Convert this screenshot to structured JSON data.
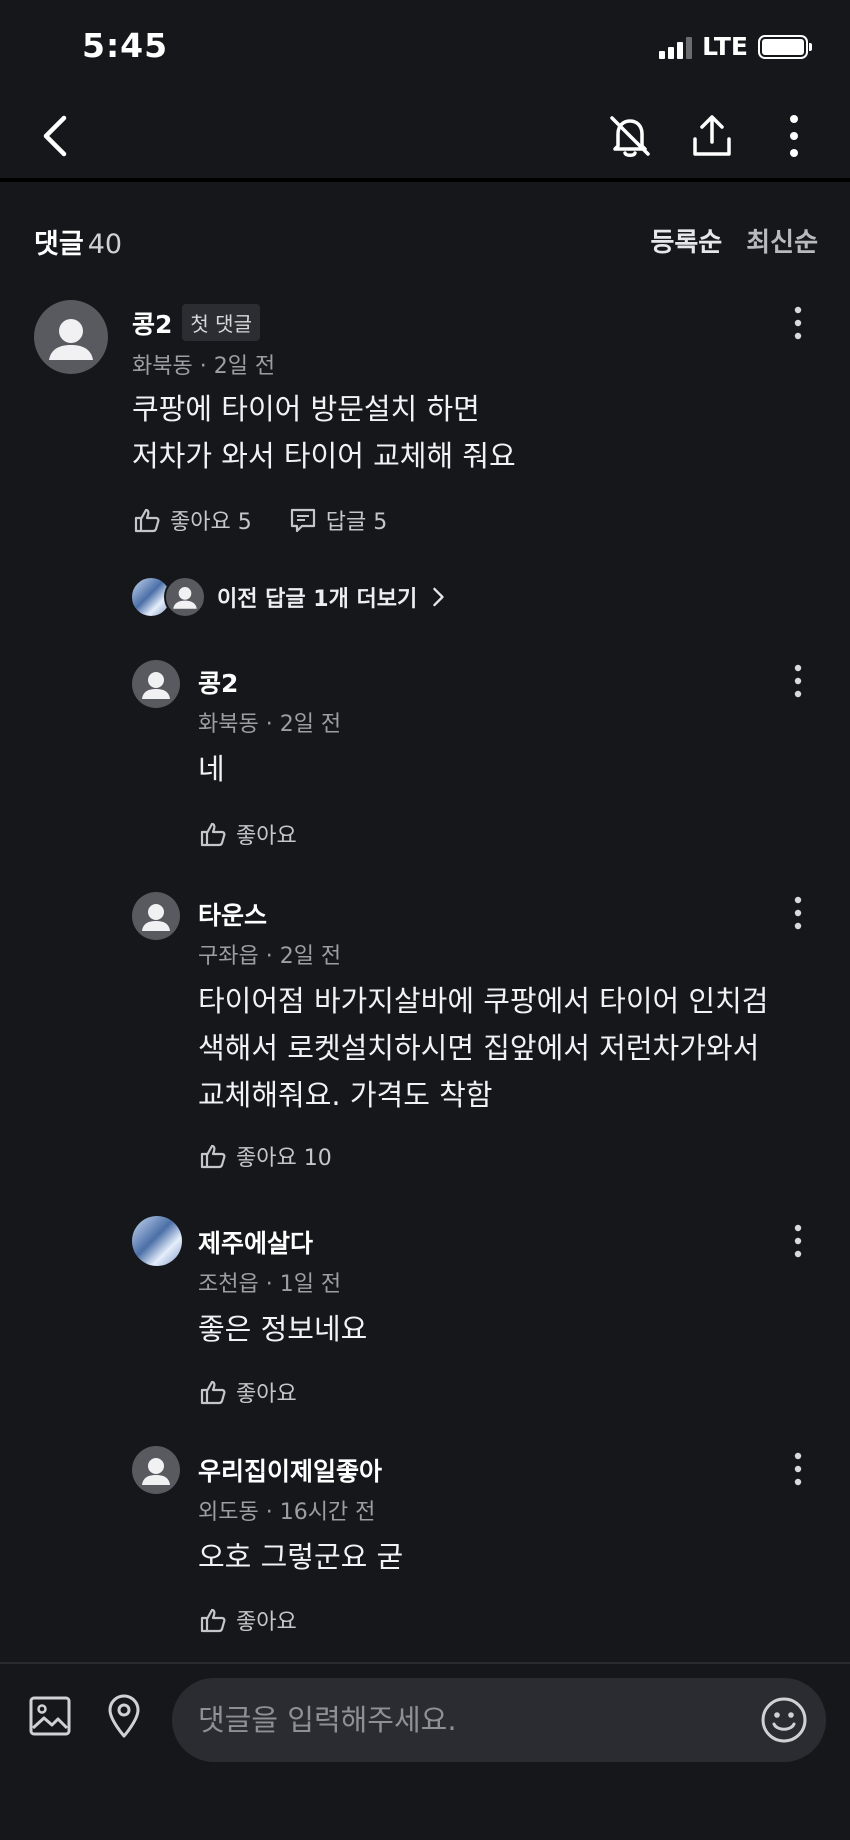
{
  "status": {
    "time": "5:45",
    "network": "LTE"
  },
  "nav": {
    "icons": [
      "back-icon",
      "bell-off-icon",
      "share-icon",
      "more-icon"
    ]
  },
  "header": {
    "title": "댓글",
    "count": "40",
    "sort": [
      "등록순",
      "최신순"
    ]
  },
  "comments": [
    {
      "name": "콩2",
      "badge": "첫 댓글",
      "meta": "화북동 · 2일 전",
      "lines": [
        "쿠팡에 타이어 방문설치 하면",
        "저차가 와서 타이어 교체해 줘요"
      ],
      "like_label": "좋아요 5",
      "reply_label": "답글 5"
    }
  ],
  "more_replies": "이전 답글 1개 더보기",
  "replies": [
    {
      "name": "콩2",
      "meta": "화북동 · 2일 전",
      "lines": [
        "네"
      ],
      "like_label": "좋아요"
    },
    {
      "name": "타운스",
      "meta": "구좌읍 · 2일 전",
      "lines": [
        "타이어점 바가지살바에 쿠팡에서 타이어 인치검",
        "색해서 로켓설치하시면 집앞에서 저런차가와서",
        "교체해줘요. 가격도 착함"
      ],
      "like_label": "좋아요 10"
    },
    {
      "name": "제주에살다",
      "meta": "조천읍 · 1일 전",
      "lines": [
        "좋은 정보네요"
      ],
      "like_label": "좋아요"
    },
    {
      "name": "우리집이제일좋아",
      "meta": "외도동 · 16시간 전",
      "lines": [
        "오호 그렇군요 굳"
      ],
      "like_label": "좋아요"
    }
  ],
  "input": {
    "placeholder": "댓글을 입력해주세요."
  },
  "colors": {
    "background": "#16171b",
    "input_bg": "#2b2c31",
    "text": "#f1f2f4",
    "meta": "#9d9ea3"
  }
}
